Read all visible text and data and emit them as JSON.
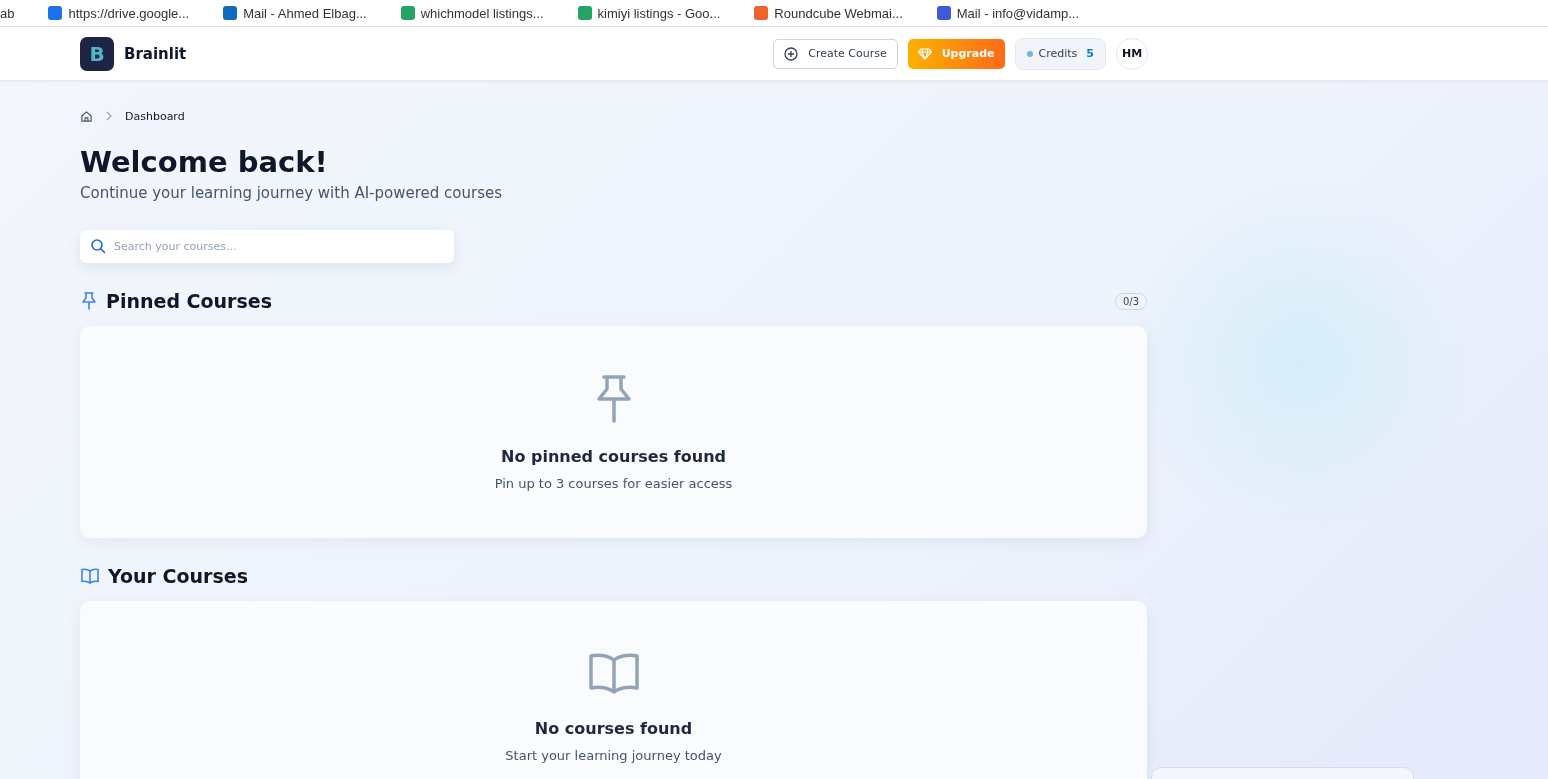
{
  "bookmarks": [
    "ab",
    "https://drive.google...",
    "Mail - Ahmed Elbag...",
    "whichmodel listings...",
    "kimiyi listings - Goo...",
    "Roundcube Webmai...",
    "Mail - info@vidamp..."
  ],
  "header": {
    "logo_letter": "B",
    "brand": "Brainlit",
    "create_button": "Create Course",
    "upgrade_button": "Upgrade",
    "credits_label": "Credits",
    "credits_value": "5",
    "avatar": "HM"
  },
  "breadcrumb": [
    "Dashboard"
  ],
  "title": "Welcome back!",
  "subtitle": "Continue your learning journey with AI-powered courses",
  "search": {
    "placeholder": "Search your courses..."
  },
  "sections": [
    {
      "kind": "pinned",
      "heading": "Pinned Courses",
      "count": "0/3",
      "empty_title": "No pinned courses found",
      "empty_text": "Pin up to 3 courses for easier access"
    },
    {
      "kind": "courses",
      "heading": "Your Courses",
      "empty_title": "No courses found",
      "empty_text": "Start your learning journey today"
    }
  ]
}
